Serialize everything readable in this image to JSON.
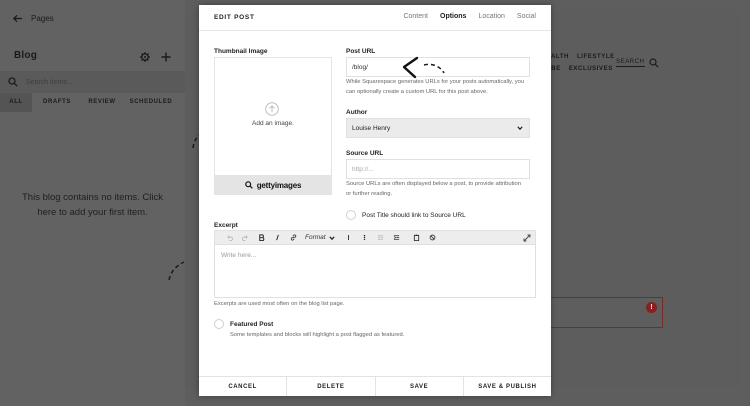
{
  "sidebar": {
    "back_label": "Pages",
    "title": "Blog",
    "search_placeholder": "Search items...",
    "filters": [
      "ALL",
      "DRAFTS",
      "REVIEW",
      "SCHEDULED"
    ],
    "empty_message": "This blog contains no items. Click here to add your first item."
  },
  "site": {
    "nav_row1": [
      "ALTH",
      "LIFESTYLE"
    ],
    "nav_row2": [
      "IBE",
      "EXCLUSIVES"
    ],
    "search_label": "SEARCH",
    "error_badge": "!"
  },
  "modal": {
    "title": "EDIT POST",
    "tabs": [
      "Content",
      "Options",
      "Location",
      "Social"
    ],
    "active_tab": "Options",
    "thumbnail": {
      "label": "Thumbnail Image",
      "add_text": "Add an image.",
      "getty_text": "gettyimages"
    },
    "post_url": {
      "label": "Post URL",
      "value": "/blog/",
      "help": "While Squarespace generates URLs for your posts automatically, you can optionally create a custom URL for this post above."
    },
    "author": {
      "label": "Author",
      "value": "Louise Henry"
    },
    "source_url": {
      "label": "Source URL",
      "placeholder": "http://...",
      "help": "Source URLs are often displayed below a post, to provide attribution or further reading."
    },
    "link_source_label": "Post Title should link to Source URL",
    "excerpt": {
      "label": "Excerpt",
      "format_label": "Format",
      "placeholder": "Write here...",
      "help": "Excerpts are used most often on the blog list page."
    },
    "featured": {
      "label": "Featured Post",
      "help": "Some templates and blocks will highlight a post flagged as featured."
    },
    "footer": {
      "cancel": "CANCEL",
      "delete": "DELETE",
      "save": "SAVE",
      "save_publish": "SAVE & PUBLISH"
    }
  },
  "colors": {
    "overlay_bg": "#5e5e5e",
    "modal_bg": "#ffffff",
    "select_bg": "#ebebeb",
    "error_red": "#8a1f1f"
  }
}
